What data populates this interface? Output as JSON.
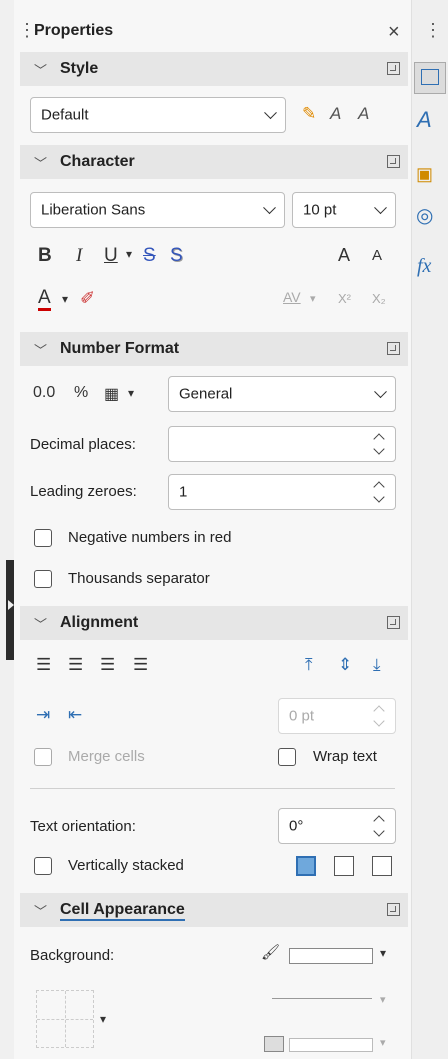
{
  "panel": {
    "title": "Properties",
    "close": "×",
    "menu": "⋮"
  },
  "sections": {
    "style": "Style",
    "character": "Character",
    "number_format": "Number Format",
    "alignment": "Alignment",
    "cell_appearance": "Cell Appearance"
  },
  "style": {
    "value": "Default"
  },
  "character": {
    "font": "Liberation Sans",
    "size": "10 pt",
    "bold": "B",
    "italic": "I",
    "underline": "U",
    "strike": "S",
    "shadow": "S",
    "grow": "A",
    "shrink": "A",
    "font_color": "A",
    "spacing": "AV",
    "superscript": "X²",
    "subscript": "X₂"
  },
  "number_format": {
    "decimal_btn": "0.0",
    "percent_btn": "%",
    "category": "General",
    "decimal_places_label": "Decimal places:",
    "decimal_places_value": "",
    "leading_zeroes_label": "Leading zeroes:",
    "leading_zeroes_value": "1",
    "negative_red": "Negative numbers in red",
    "thousands": "Thousands separator"
  },
  "alignment": {
    "indent_value": "0 pt",
    "merge_cells": "Merge cells",
    "wrap_text": "Wrap text",
    "text_orientation_label": "Text orientation:",
    "text_orientation_value": "0°",
    "vertically_stacked": "Vertically stacked"
  },
  "cell_appearance": {
    "background_label": "Background:"
  }
}
